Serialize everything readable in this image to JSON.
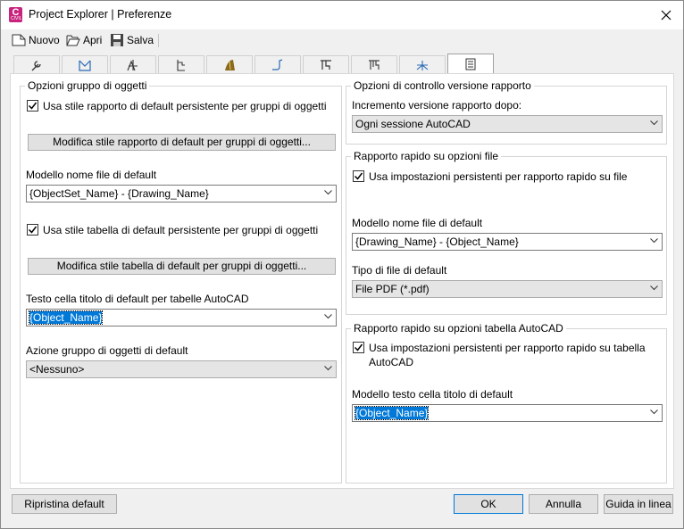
{
  "window": {
    "title": "Project Explorer | Preferenze",
    "app_icon_letter": "C",
    "app_icon_sub": "CIVIL"
  },
  "toolbar": {
    "new_label": "Nuovo",
    "open_label": "Apri",
    "save_label": "Salva"
  },
  "tabs": [
    {
      "icon": "wrench-icon"
    },
    {
      "icon": "surface-icon"
    },
    {
      "icon": "alignment-icon"
    },
    {
      "icon": "profile-icon"
    },
    {
      "icon": "corridor-icon"
    },
    {
      "icon": "pipe-network-icon"
    },
    {
      "icon": "pressure-network-icon"
    },
    {
      "icon": "structure-icon"
    },
    {
      "icon": "section-icon"
    },
    {
      "icon": "report-icon"
    }
  ],
  "left": {
    "group_title": "Opzioni gruppo di oggetti",
    "chk_report_style": "Usa stile rapporto di default persistente per gruppi di oggetti",
    "btn_report_style": "Modifica stile rapporto di default per gruppi di oggetti...",
    "filename_label": "Modello nome file di default",
    "filename_value": "{ObjectSet_Name} - {Drawing_Name}",
    "chk_table_style": "Usa stile tabella di default persistente per gruppi di oggetti",
    "btn_table_style": "Modifica stile tabella di default per gruppi di oggetti...",
    "title_cell_label": "Testo cella titolo di default per tabelle AutoCAD",
    "title_cell_value": "{Object_Name}",
    "action_label": "Azione gruppo di oggetti di default",
    "action_value": "<Nessuno>"
  },
  "right_version": {
    "group_title": "Opzioni di controllo versione rapporto",
    "increment_label": "Incremento versione rapporto dopo:",
    "increment_value": "Ogni sessione AutoCAD"
  },
  "right_file": {
    "group_title": "Rapporto rapido su opzioni file",
    "chk_persistent": "Usa impostazioni persistenti per rapporto rapido su file",
    "filename_label": "Modello nome file di default",
    "filename_value": "{Drawing_Name} - {Object_Name}",
    "filetype_label": "Tipo di file di default",
    "filetype_value": "File PDF (*.pdf)"
  },
  "right_table": {
    "group_title": "Rapporto rapido su opzioni tabella AutoCAD",
    "chk_persistent_line1": "Usa impostazioni persistenti per rapporto rapido su tabella",
    "chk_persistent_line2": "AutoCAD",
    "title_cell_label": "Modello testo cella titolo di default",
    "title_cell_value": "{Object_Name}"
  },
  "footer": {
    "reset_label": "Ripristina default",
    "ok_label": "OK",
    "cancel_label": "Annulla",
    "help_label": "Guida in linea"
  },
  "colors": {
    "accent": "#0078d7",
    "app_icon": "#c8247e"
  }
}
